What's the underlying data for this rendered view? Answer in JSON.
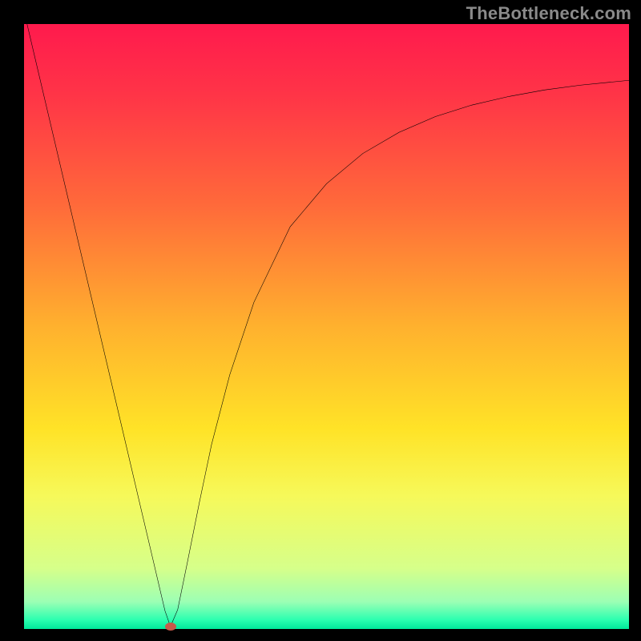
{
  "watermark": "TheBottleneck.com",
  "chart_data": {
    "type": "line",
    "title": "",
    "xlabel": "",
    "ylabel": "",
    "xlim": [
      0,
      100
    ],
    "ylim": [
      0,
      100
    ],
    "grid": false,
    "legend": false,
    "gradient_stops": [
      {
        "offset": 0.0,
        "color": "#ff1a4d"
      },
      {
        "offset": 0.12,
        "color": "#ff3547"
      },
      {
        "offset": 0.3,
        "color": "#ff6a3a"
      },
      {
        "offset": 0.5,
        "color": "#ffb12e"
      },
      {
        "offset": 0.67,
        "color": "#ffe327"
      },
      {
        "offset": 0.78,
        "color": "#f6f95a"
      },
      {
        "offset": 0.9,
        "color": "#d6ff8a"
      },
      {
        "offset": 0.955,
        "color": "#9cffb4"
      },
      {
        "offset": 0.985,
        "color": "#2bffb0"
      },
      {
        "offset": 1.0,
        "color": "#00e89a"
      }
    ],
    "series": [
      {
        "name": "bottleneck-curve",
        "type": "line",
        "color": "#000000",
        "x": [
          0.5,
          4,
          8,
          12,
          16,
          19,
          21,
          22.5,
          23.3,
          24.2,
          25.4,
          27,
          29,
          31,
          34,
          38,
          44,
          50,
          56,
          62,
          68,
          74,
          80,
          86,
          92,
          98,
          100
        ],
        "y": [
          100,
          85.1,
          68.1,
          51.1,
          34.1,
          21.3,
          12.8,
          6.4,
          3.0,
          0.4,
          3.2,
          11.0,
          21.0,
          30.5,
          42.0,
          54.0,
          66.5,
          73.6,
          78.6,
          82.1,
          84.7,
          86.6,
          88.0,
          89.1,
          89.9,
          90.5,
          90.7
        ]
      }
    ],
    "marker": {
      "x": 24.2,
      "y": 0.4,
      "color": "#c85a4a"
    }
  }
}
